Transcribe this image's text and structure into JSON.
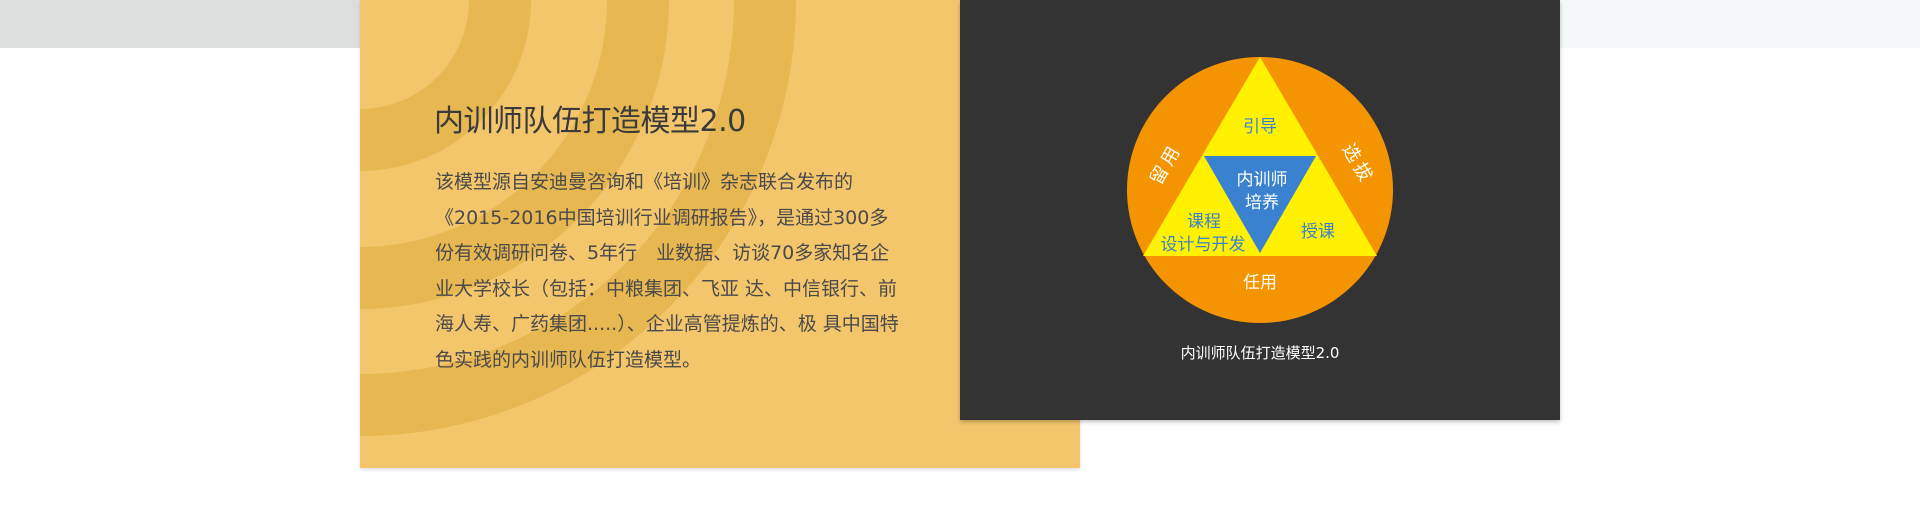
{
  "title": "内训师队伍打造模型2.0",
  "description": "该模型源自安迪曼咨询和《培训》杂志联合发布的《2015-2016中国培训行业调研报告》，是通过300多份有效调研问卷、5年行　业数据、访谈70多家知名企业大学校长（包括：中粮集团、飞亚 达、中信银行、前海人寿、广药集团.....）、企业高管提炼的、极 具中国特色实践的内训师队伍打造模型。",
  "diagram": {
    "center_line1": "内训师",
    "center_line2": "培养",
    "top": "引导",
    "bottom_left_line1": "课程",
    "bottom_left_line2": "设计与开发",
    "bottom_right": "授课",
    "left_arc": "留用",
    "right_arc": "选拔",
    "bottom_arc": "任用",
    "caption": "内训师队伍打造模型2.0"
  },
  "colors": {
    "yellow_card": "#f3c66c",
    "dark_card": "#333333",
    "circle_orange": "#f39400",
    "triangle_yellow": "#fff100",
    "center_blue": "#3a82cf",
    "label_blue": "#3a82cf"
  }
}
